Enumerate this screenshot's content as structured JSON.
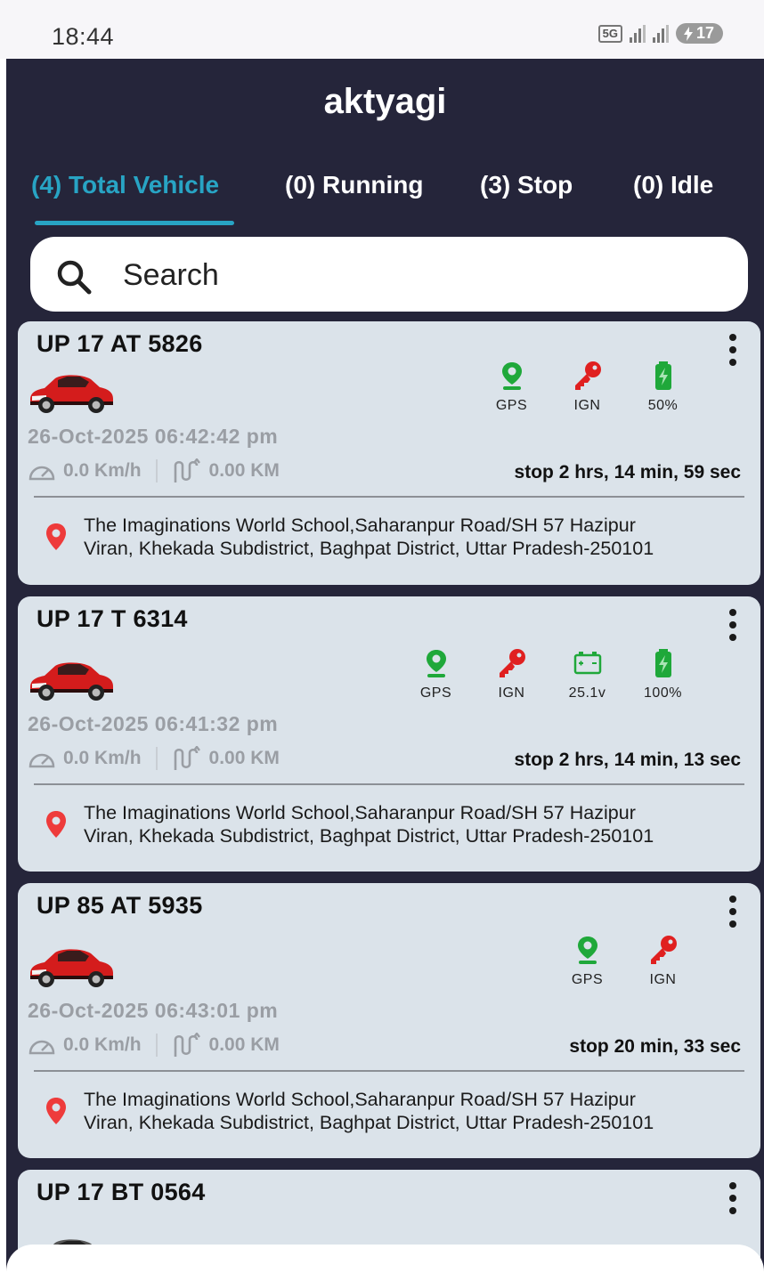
{
  "status_bar": {
    "time": "18:44",
    "network": "5G",
    "battery": "17"
  },
  "app": {
    "title": "aktyagi"
  },
  "tabs": [
    {
      "label": "(4) Total Vehicle",
      "active": true
    },
    {
      "label": "(0) Running",
      "active": false
    },
    {
      "label": "(3) Stop",
      "active": false
    },
    {
      "label": "(0) Idle",
      "active": false
    }
  ],
  "search": {
    "placeholder": "Search"
  },
  "colors": {
    "header_bg": "#25253a",
    "accent": "#28a4c4",
    "card_bg": "#dbe3ea",
    "gps_green": "#1fa83a",
    "ign_red": "#e02020",
    "pin_red": "#ee3b3b"
  },
  "vehicles": [
    {
      "plate": "UP 17 AT 5826",
      "datetime": "26-Oct-2025 06:42:42 pm",
      "speed": "0.0 Km/h",
      "distance": "0.00 KM",
      "stop_time": "stop 2 hrs, 14 min, 59 sec",
      "address_line1": "The Imaginations World School,Saharanpur Road/SH 57 Hazipur",
      "address_line2": "Viran, Khekada Subdistrict, Baghpat District, Uttar Pradesh-250101",
      "status": {
        "gps": "GPS",
        "ign": "IGN",
        "battery": "50%"
      }
    },
    {
      "plate": "UP 17 T 6314",
      "datetime": "26-Oct-2025 06:41:32 pm",
      "speed": "0.0 Km/h",
      "distance": "0.00 KM",
      "stop_time": "stop 2 hrs, 14 min, 13 sec",
      "address_line1": "The Imaginations World School,Saharanpur Road/SH 57 Hazipur",
      "address_line2": "Viran, Khekada Subdistrict, Baghpat District, Uttar Pradesh-250101",
      "status": {
        "gps": "GPS",
        "ign": "IGN",
        "voltage": "25.1v",
        "battery": "100%"
      }
    },
    {
      "plate": "UP 85 AT 5935",
      "datetime": "26-Oct-2025 06:43:01 pm",
      "speed": "0.0 Km/h",
      "distance": "0.00 KM",
      "stop_time": "stop 20 min, 33 sec",
      "address_line1": "The Imaginations World School,Saharanpur Road/SH 57 Hazipur",
      "address_line2": "Viran, Khekada Subdistrict, Baghpat District, Uttar Pradesh-250101",
      "status": {
        "gps": "GPS",
        "ign": "IGN"
      }
    },
    {
      "plate": "UP 17 BT 0564"
    }
  ]
}
